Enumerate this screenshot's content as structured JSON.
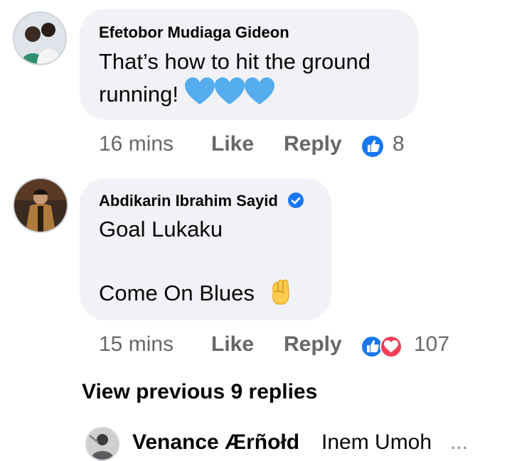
{
  "comments": [
    {
      "author": "Efetobor Mudiaga Gideon",
      "text_line1": "That’s how to hit the ground",
      "text_line2": "running!",
      "emoji_names": [
        "blue-heart-icon",
        "blue-heart-icon",
        "blue-heart-icon"
      ],
      "time": "16 mins",
      "like_label": "Like",
      "reply_label": "Reply",
      "reactions": [
        "like-reaction-icon"
      ],
      "reaction_count": "8"
    },
    {
      "author": "Abdikarin Ibrahim Sayid",
      "verified": true,
      "text_line1": "Goal  Lukaku",
      "text_line2": "Come On Blues",
      "emoji_names": [
        "raised-fist-icon"
      ],
      "time": "15 mins",
      "like_label": "Like",
      "reply_label": "Reply",
      "reactions": [
        "like-reaction-icon",
        "love-reaction-icon"
      ],
      "reaction_count": "107"
    }
  ],
  "view_previous": "View previous 9 replies",
  "latest_reply": {
    "author": "Venance Ærñołd",
    "preview": "Inem Umoh",
    "ellipsis": "..."
  },
  "colors": {
    "bubble": "#f0f2f5",
    "meta_text": "#65676b",
    "like_blue": "#1877f2",
    "love_red": "#f33e58",
    "heart_blue": "#55acee"
  }
}
